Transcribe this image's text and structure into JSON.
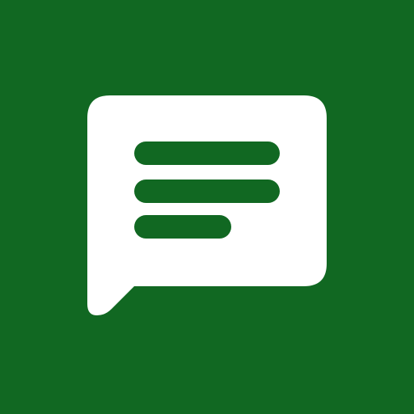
{
  "icon": {
    "name": "message-text-icon",
    "background_color": "#116822",
    "bubble_color": "#ffffff",
    "line_color": "#116822"
  }
}
